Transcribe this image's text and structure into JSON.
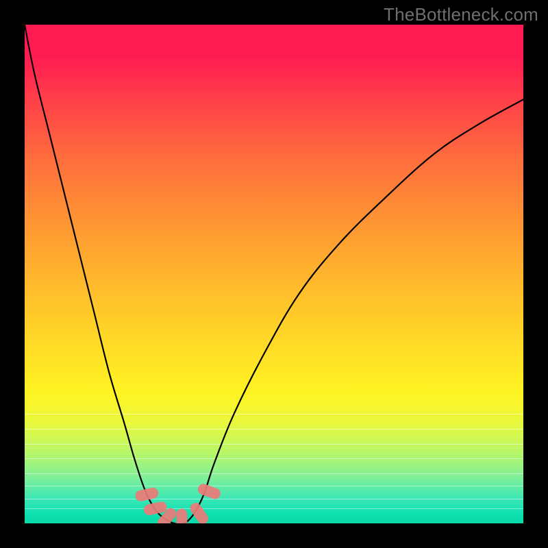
{
  "watermark": "TheBottleneck.com",
  "chart_data": {
    "type": "line",
    "title": "",
    "xlabel": "",
    "ylabel": "",
    "xlim": [
      0,
      1
    ],
    "ylim": [
      0,
      1
    ],
    "note": "V-shaped bottleneck curve; x is normalized configuration axis, y is normalized bottleneck percentage (0 = no bottleneck at minimum). Red markers highlight the near-minimum region.",
    "series": [
      {
        "name": "bottleneck-curve",
        "x": [
          0.0,
          0.02,
          0.05,
          0.08,
          0.11,
          0.14,
          0.17,
          0.2,
          0.22,
          0.24,
          0.26,
          0.28,
          0.3,
          0.32,
          0.34,
          0.36,
          0.38,
          0.42,
          0.48,
          0.55,
          0.63,
          0.72,
          0.82,
          0.91,
          1.0
        ],
        "y": [
          1.0,
          0.9,
          0.78,
          0.66,
          0.54,
          0.42,
          0.3,
          0.2,
          0.13,
          0.07,
          0.03,
          0.01,
          0.0,
          0.0,
          0.02,
          0.06,
          0.12,
          0.22,
          0.34,
          0.46,
          0.56,
          0.65,
          0.74,
          0.8,
          0.85
        ]
      }
    ],
    "markers": {
      "name": "near-minimum-highlight",
      "color": "#ed7a77",
      "points": [
        {
          "x": 0.245,
          "y": 0.058
        },
        {
          "x": 0.262,
          "y": 0.03
        },
        {
          "x": 0.285,
          "y": 0.01
        },
        {
          "x": 0.315,
          "y": 0.006
        },
        {
          "x": 0.35,
          "y": 0.02
        },
        {
          "x": 0.37,
          "y": 0.064
        }
      ]
    },
    "gradient_stops": [
      {
        "pos": 0.0,
        "color": "#ff1a52"
      },
      {
        "pos": 0.5,
        "color": "#ffbf2b"
      },
      {
        "pos": 0.78,
        "color": "#fff423"
      },
      {
        "pos": 1.0,
        "color": "#0ad9a8"
      }
    ]
  }
}
